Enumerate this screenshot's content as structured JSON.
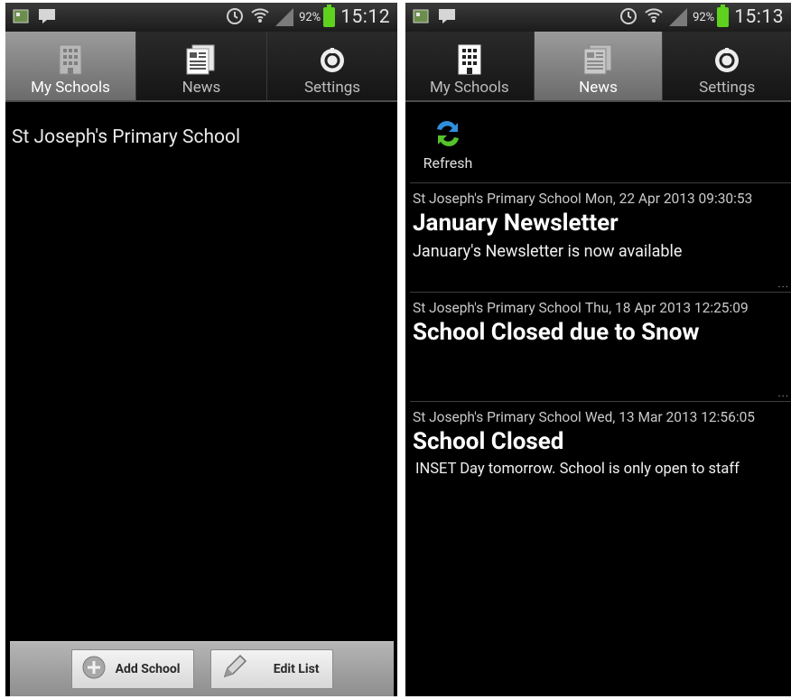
{
  "status_left": {
    "time": "15:12",
    "battery": "92%"
  },
  "status_right": {
    "time": "15:13",
    "battery": "92%"
  },
  "tabs_left": [
    {
      "label": "My Schools",
      "active": true
    },
    {
      "label": "News",
      "active": false
    },
    {
      "label": "Settings",
      "active": false
    }
  ],
  "tabs_right": [
    {
      "label": "My Schools",
      "active": false
    },
    {
      "label": "News",
      "active": true
    },
    {
      "label": "Settings",
      "active": false
    }
  ],
  "schools": [
    "St Joseph's Primary School"
  ],
  "bottom_bar": {
    "add_label": "Add School",
    "edit_label": "Edit List"
  },
  "refresh_label": "Refresh",
  "news": [
    {
      "school": "St Joseph's Primary School",
      "date": "Mon, 22 Apr 2013 09:30:53",
      "title": "January Newsletter",
      "body": "January's Newsletter is now available",
      "more": "..."
    },
    {
      "school": "St Joseph's Primary School",
      "date": "Thu, 18 Apr 2013 12:25:09",
      "title": "School Closed due to Snow",
      "body": "",
      "more": "..."
    },
    {
      "school": "St Joseph's Primary School",
      "date": "Wed, 13 Mar 2013 12:56:05",
      "title": "School Closed",
      "body": "INSET Day tomorrow.  School is only open to staff",
      "more": ""
    }
  ],
  "colors": {
    "accent_battery": "#5ed21d",
    "active_tab": "#8a8a8a",
    "background": "#000000"
  }
}
